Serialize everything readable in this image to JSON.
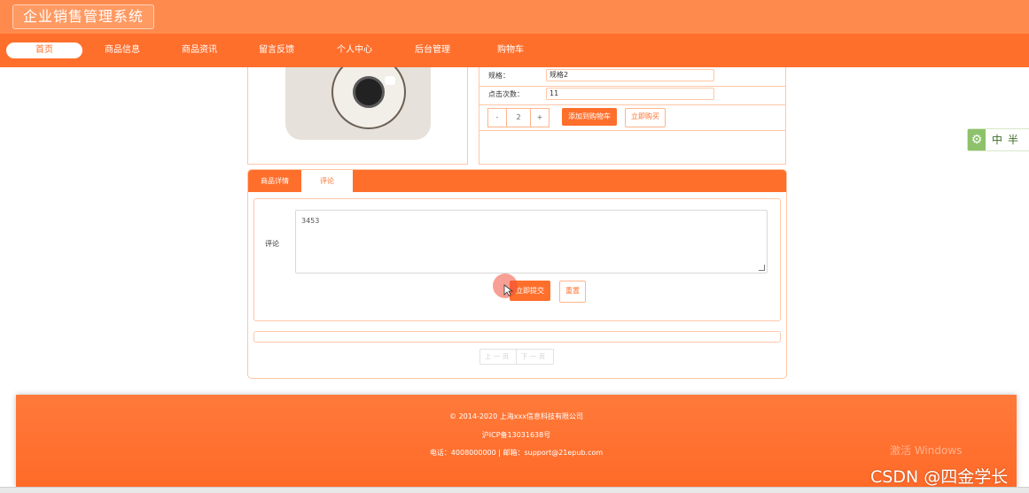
{
  "header": {
    "title": "企业销售管理系统"
  },
  "nav": {
    "items": [
      {
        "label": "首页",
        "active": true
      },
      {
        "label": "商品信息"
      },
      {
        "label": "商品资讯"
      },
      {
        "label": "留言反馈"
      },
      {
        "label": "个人中心"
      },
      {
        "label": "后台管理"
      },
      {
        "label": "购物车"
      }
    ]
  },
  "product": {
    "spec_label": "规格：",
    "spec_value": "规格2",
    "clicks_label": "点击次数：",
    "clicks_value": "11",
    "qty_minus": "-",
    "qty_value": "2",
    "qty_plus": "+",
    "add_to_cart": "添加到购物车",
    "buy_now": "立即购买"
  },
  "tabs": [
    {
      "label": "商品详情"
    },
    {
      "label": "评论",
      "active": true
    }
  ],
  "comment_form": {
    "label": "评论",
    "value": "3453",
    "submit_label": "立即提交",
    "reset_label": "重置"
  },
  "pagination": {
    "prev": "上一页",
    "next": "下一页"
  },
  "lang_widget": {
    "text": "中半"
  },
  "footer": {
    "copyright": "© 2014-2020 上海xxx信息科技有限公司",
    "icp": "沪ICP备13031638号",
    "contact": "电话：4008000000 | 邮箱：support@21epub.com"
  },
  "overlays": {
    "windows": "激活 Windows",
    "csdn": "CSDN @四金学长"
  },
  "colors": {
    "header": "#ff8a4d",
    "nav": "#ff6f2c",
    "accent": "#ff6f2c",
    "footer": "#ff6f2c"
  }
}
